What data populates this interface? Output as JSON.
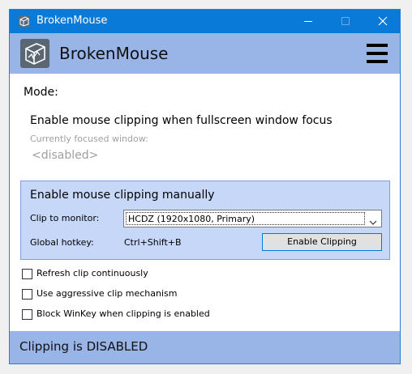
{
  "window": {
    "title": "BrokenMouse",
    "accent_color": "#0a7ad8",
    "header_color": "#99b4e6",
    "controls": [
      "minimize-icon",
      "maximize-icon",
      "close-icon"
    ]
  },
  "header": {
    "app_name": "BrokenMouse",
    "logo_icon": "broken-cube-logo-icon",
    "menu_icon": "hamburger-menu-icon"
  },
  "mode": {
    "label": "Mode:",
    "fullscreen": {
      "title": "Enable mouse clipping when fullscreen window focus",
      "focused_label": "Currently focused window:",
      "focused_value": "<disabled>"
    },
    "manual": {
      "title": "Enable mouse clipping manually",
      "monitor_label": "Clip to monitor:",
      "monitor_selected": "HCDZ (1920x1080, Primary)",
      "hotkey_label": "Global hotkey:",
      "hotkey_value": "Ctrl+Shift+B",
      "enable_button": "Enable Clipping",
      "box_color": "#c7d7f7"
    }
  },
  "options": [
    {
      "label": "Refresh clip continuously",
      "checked": false
    },
    {
      "label": "Use aggressive clip mechanism",
      "checked": false
    },
    {
      "label": "Block WinKey when clipping is enabled",
      "checked": false
    }
  ],
  "status": {
    "text": "Clipping is DISABLED"
  }
}
